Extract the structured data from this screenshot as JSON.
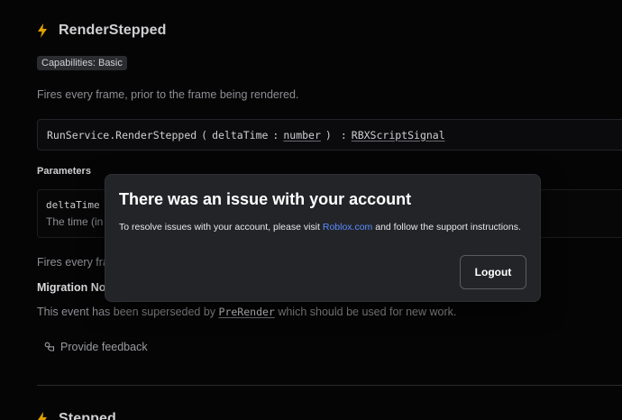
{
  "event": {
    "title": "RenderStepped",
    "capability_badge": "Capabilities: Basic",
    "description": "Fires every frame, prior to the frame being rendered.",
    "signature": {
      "prefix": "RunService.RenderStepped",
      "open_paren": "(",
      "param_name": "deltaTime",
      "colon": ":",
      "param_type": "number",
      "close_paren": ")",
      "return_type": "RBXScriptSignal"
    },
    "parameters_label": "Parameters",
    "parameter": {
      "name": "deltaTime :",
      "desc": "The time (in"
    },
    "fires_text": "Fires every fra",
    "migration_heading": "Migration No",
    "superseded_prefix": "This event has been superseded by",
    "superseded_code": "PreRender",
    "superseded_suffix": "which should be used for new work.",
    "feedback_label": "Provide feedback",
    "accent_color": "#e0a100"
  },
  "next_event": {
    "title": "Stepped"
  },
  "modal": {
    "title": "There was an issue with your account",
    "body_prefix": "To resolve issues with your account, please visit",
    "body_link": "Roblox.com",
    "body_suffix": "and follow the support instructions.",
    "button_label": "Logout",
    "link_color": "#5b8cff"
  }
}
